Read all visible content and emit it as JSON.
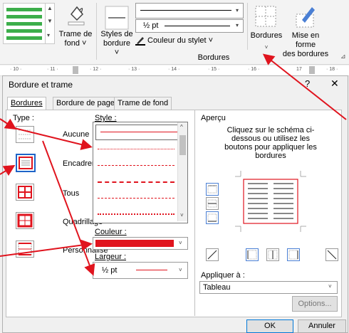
{
  "ribbon": {
    "trame_de_fond": "Trame de\nfond ˅",
    "styles_de_bordure": "Styles de\nbordure ˅",
    "width_value": "½ pt",
    "couleur_du_stylet": "Couleur du stylet ˅",
    "bordures": "Bordures",
    "bordures_chev": "˅",
    "mise_en_forme": "Mise en forme\ndes bordures",
    "group_label": "Bordures"
  },
  "ruler": {
    "ticks": [
      "· 10 ·",
      "· 11 ·",
      "· 12 ·",
      "· 13 ·",
      "· 14 ·",
      "· 15 ·",
      "· 16 ·",
      "17",
      "· 18 ·"
    ]
  },
  "dialog": {
    "title": "Bordure et trame",
    "help": "?",
    "close": "✕",
    "tabs": [
      "Bordures",
      "Bordure de page",
      "Trame de fond"
    ],
    "type_label": "Type :",
    "types": [
      "Aucune",
      "Encadrement",
      "Tous",
      "Quadrillage",
      "Personnalisé"
    ],
    "style_label": "Style :",
    "couleur_label": "Couleur :",
    "largeur_label": "Largeur :",
    "largeur_value": "½ pt",
    "apercu_label": "Aperçu",
    "apercu_help": "Cliquez sur le schéma ci-dessous ou utilisez les boutons pour appliquer les bordures",
    "appliquer_label": "Appliquer à :",
    "appliquer_value": "Tableau",
    "options": "Options...",
    "ok": "OK",
    "annuler": "Annuler"
  },
  "colors": {
    "accent_red": "#e0141e",
    "selection_blue": "#1e64c8",
    "green": "#3cae4a"
  }
}
